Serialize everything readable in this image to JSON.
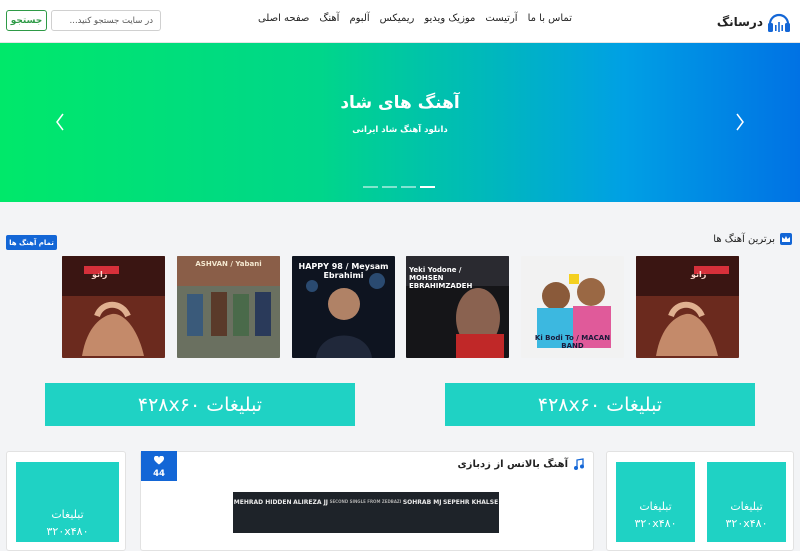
{
  "brand": {
    "name": "درسانگ",
    "logo_icon": "headphones-icon",
    "color": "#1366d6"
  },
  "nav": [
    "صفحه اصلی",
    "آهنگ",
    "آلبوم",
    "ریمیکس",
    "موزیک ویدیو",
    "آرتیست",
    "تماس با ما"
  ],
  "search": {
    "placeholder": "در سایت جستجو کنید...",
    "button": "جستجو"
  },
  "hero": {
    "title": "آهنگ های شاد",
    "subtitle": "دانلود آهنگ شاد ایرانی",
    "slides": 4,
    "active_slide": 4,
    "gradient": [
      "#00e86a",
      "#0072e4"
    ]
  },
  "top_songs": {
    "title": "برترین آهنگ ها",
    "all_button": "تمام آهنگ ها",
    "covers": [
      {
        "text": "زانو"
      },
      {
        "text": "Ki Bodi To / MACAN BAND"
      },
      {
        "text": "Yeki Yodone / MOHSEN EBRAHIMZADEH"
      },
      {
        "text": "HAPPY 98 / Meysam Ebrahimi"
      },
      {
        "text": "ASHVAN / Yabani"
      },
      {
        "text": "زانو"
      }
    ]
  },
  "ads": {
    "wide": "تبلیغات ۴۲۸x۶۰",
    "box_label": "تبلیغات",
    "box_size": "۳۲۰x۴۸۰",
    "color": "#1fd2c4"
  },
  "post": {
    "title": "آهنگ بالانس از زدبازی",
    "likes": "44",
    "cover_names": [
      "MEHRAD HIDDEN",
      "ALIREZA JJ",
      "SOHRAB MJ",
      "SEPEHR KHALSE"
    ],
    "cover_caption": "SECOND SINGLE FROM ZEDBAZI"
  }
}
